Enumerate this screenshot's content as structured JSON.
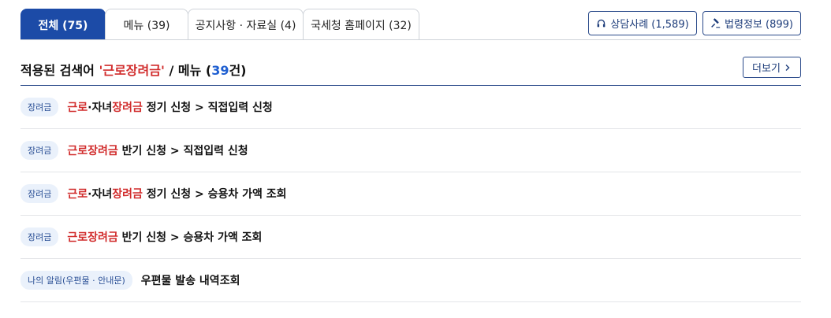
{
  "tabs": [
    {
      "label": "전체 (75)",
      "active": true
    },
    {
      "label": "메뉴 (39)",
      "active": false
    },
    {
      "label": "공지사항 · 자료실 (4)",
      "active": false
    },
    {
      "label": "국세청 홈페이지 (32)",
      "active": false
    }
  ],
  "quick_links": {
    "consult_label": "상담사례 (1,589)",
    "law_label": "법령정보 (899)"
  },
  "heading": {
    "prefix": "적용된 검색어 ",
    "keyword": "'근로장려금'",
    "middle": " / 메뉴 (",
    "count": "39",
    "suffix": "건)"
  },
  "more_label": "더보기",
  "results": [
    {
      "badge": "장려금",
      "segments": [
        {
          "text": "근로",
          "hl": true
        },
        {
          "text": "·자녀",
          "hl": false
        },
        {
          "text": "장려금",
          "hl": true
        },
        {
          "text": " 정기 신청 > 직접입력 신청",
          "hl": false
        }
      ]
    },
    {
      "badge": "장려금",
      "segments": [
        {
          "text": "근로장려금",
          "hl": true
        },
        {
          "text": " 반기 신청 > 직접입력 신청",
          "hl": false
        }
      ]
    },
    {
      "badge": "장려금",
      "segments": [
        {
          "text": "근로",
          "hl": true
        },
        {
          "text": "·자녀",
          "hl": false
        },
        {
          "text": "장려금",
          "hl": true
        },
        {
          "text": " 정기 신청 > 승용차 가액 조회",
          "hl": false
        }
      ]
    },
    {
      "badge": "장려금",
      "segments": [
        {
          "text": "근로장려금",
          "hl": true
        },
        {
          "text": " 반기 신청 > 승용차 가액 조회",
          "hl": false
        }
      ]
    },
    {
      "badge": "나의 알림(우편물 · 안내문)",
      "segments": [
        {
          "text": "우편물 발송 내역조회",
          "hl": false
        }
      ]
    }
  ],
  "colors": {
    "tab_active": "#1c4ba7",
    "highlight": "#d12c2c",
    "count": "#1f5fd1",
    "badge_bg": "#eaf1fb",
    "badge_text": "#2a4f95"
  },
  "icons": {
    "consult": "headset-icon",
    "law": "gavel-icon",
    "more": "chevron-right-icon"
  }
}
